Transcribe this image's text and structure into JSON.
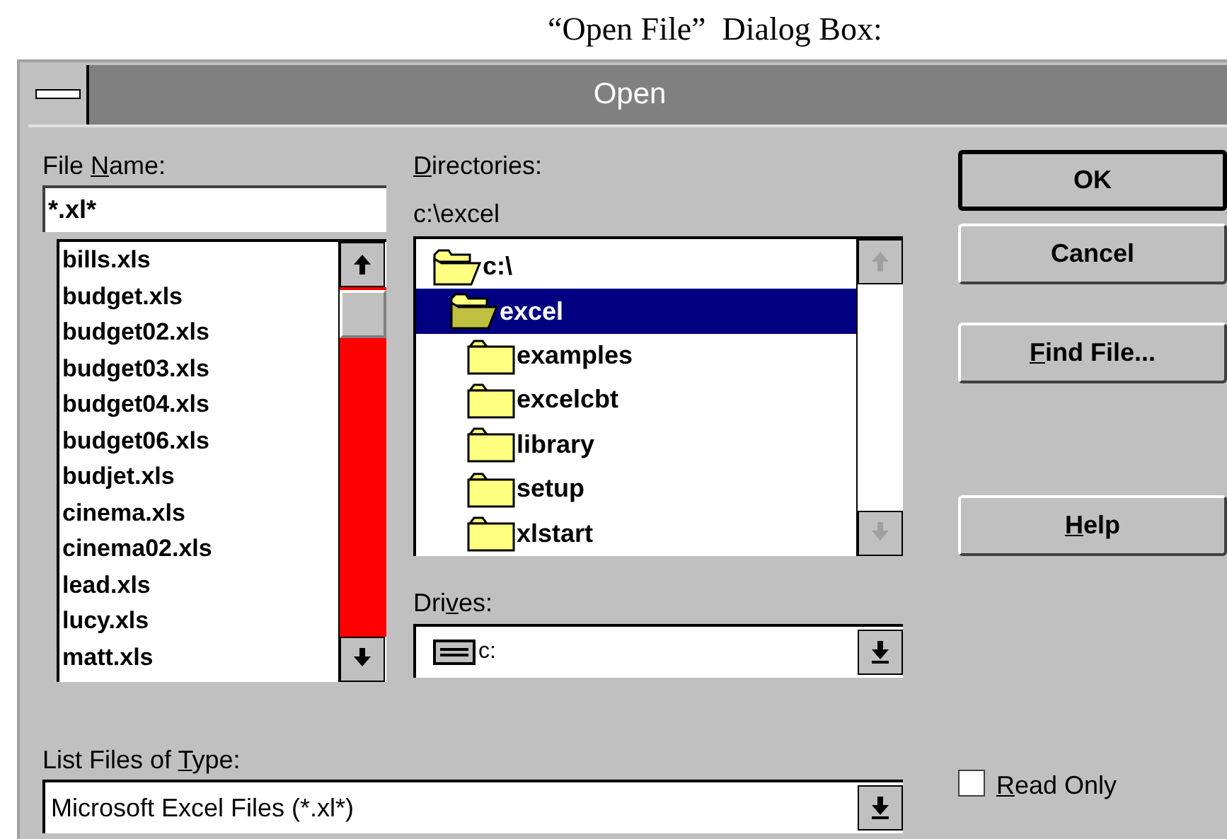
{
  "caption": "“Open File”  Dialog Box:",
  "window": {
    "title": "Open"
  },
  "file_name": {
    "label": {
      "before": "File ",
      "key": "N",
      "after": "ame:"
    },
    "value": "*.xl*"
  },
  "files": [
    {
      "name": "bills.xls",
      "selected": false
    },
    {
      "name": "budget.xls",
      "selected": false
    },
    {
      "name": "budget02.xls",
      "selected": false
    },
    {
      "name": "budget03.xls",
      "selected": false
    },
    {
      "name": "budget04.xls",
      "selected": false
    },
    {
      "name": "budget06.xls",
      "selected": false
    },
    {
      "name": "budjet.xls",
      "selected": false
    },
    {
      "name": "cinema.xls",
      "selected": false
    },
    {
      "name": "cinema02.xls",
      "selected": false
    },
    {
      "name": "lead.xls",
      "selected": false
    },
    {
      "name": "lucy.xls",
      "selected": false
    },
    {
      "name": "matt.xls",
      "selected": false
    }
  ],
  "directories": {
    "label": {
      "key": "D",
      "after": "irectories:"
    },
    "path": "c:\\excel",
    "tree": [
      {
        "name": "c:\\",
        "expanded": true,
        "selected": false,
        "children": [
          {
            "name": "excel",
            "expanded": true,
            "selected": true,
            "children": [
              {
                "name": "examples",
                "expanded": false,
                "selected": false
              },
              {
                "name": "excelcbt",
                "expanded": false,
                "selected": false
              },
              {
                "name": "library",
                "expanded": false,
                "selected": false
              },
              {
                "name": "setup",
                "expanded": false,
                "selected": false
              },
              {
                "name": "xlstart",
                "expanded": false,
                "selected": false
              }
            ]
          }
        ]
      }
    ]
  },
  "drives": {
    "label": {
      "before": "Dri",
      "key": "v",
      "after": "es:"
    },
    "value": "c:"
  },
  "file_type": {
    "label": {
      "before": "List Files of ",
      "key": "T",
      "after": "ype:"
    },
    "value": "Microsoft Excel Files (*.xl*)"
  },
  "buttons": [
    {
      "label": {
        "after": "OK"
      },
      "default": true
    },
    {
      "label": {
        "after": "Cancel"
      },
      "default": false
    },
    {
      "label": {
        "key": "F",
        "after": "ind File..."
      },
      "default": false
    },
    {
      "label": {
        "key": "H",
        "after": "elp"
      },
      "default": false
    }
  ],
  "read_only": {
    "label": {
      "key": "R",
      "after": "ead Only"
    },
    "checked": false
  }
}
